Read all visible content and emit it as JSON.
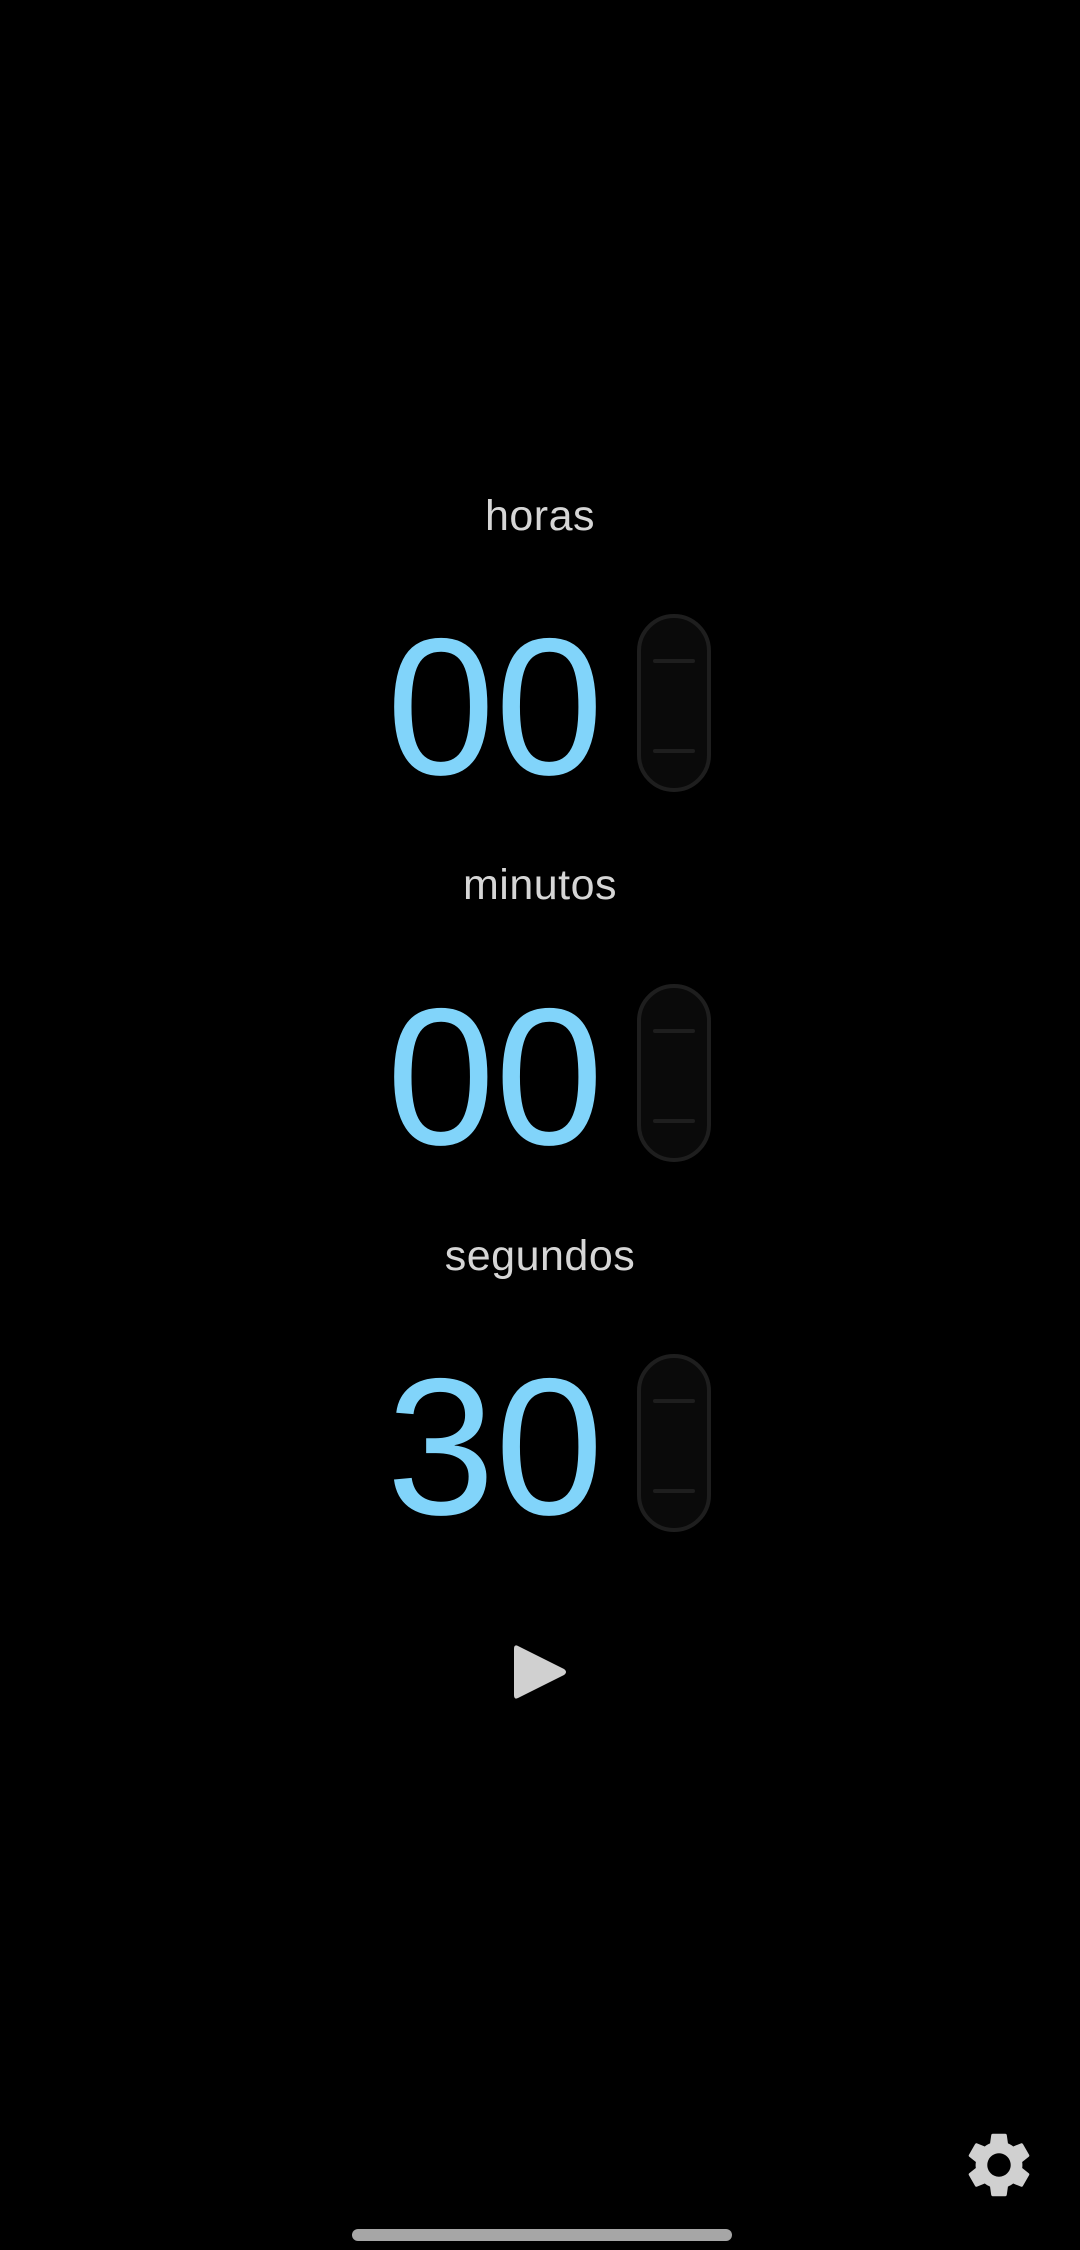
{
  "timer": {
    "hours": {
      "label": "horas",
      "value": "00"
    },
    "minutes": {
      "label": "minutos",
      "value": "00"
    },
    "seconds": {
      "label": "segundos",
      "value": "30"
    }
  },
  "controls": {
    "play_icon": "play-icon",
    "settings_icon": "gear-icon"
  },
  "colors": {
    "background": "#000000",
    "digits": "#81d4fa",
    "labels": "#d6d6d6",
    "icons": "#d0d0d0"
  }
}
